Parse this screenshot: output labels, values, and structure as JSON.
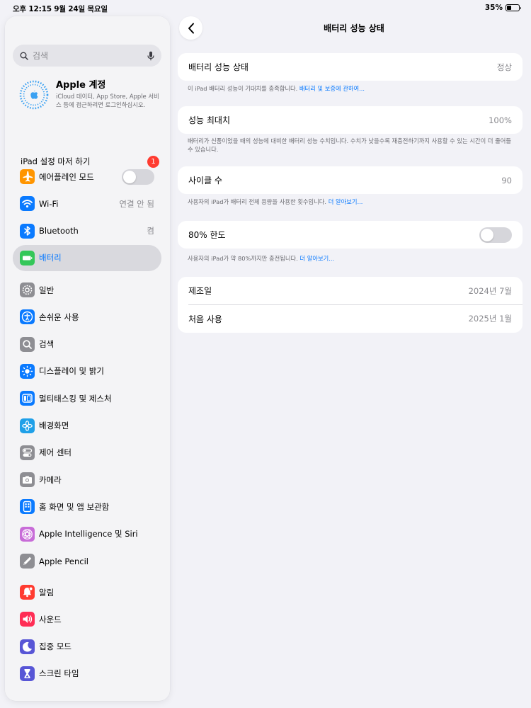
{
  "status_bar": {
    "time": "오후 12:15  9월 24일 목요일",
    "battery_pct": "35%",
    "battery_level": 0.35
  },
  "sidebar": {
    "search_placeholder": "검색",
    "apple_account": {
      "title": "Apple 계정",
      "desc": "iCloud 데이터, App Store, Apple 서비스 등에 접근하려면 로그인하십시오."
    },
    "setup": {
      "label": "iPad 설정 마저 하기",
      "badge": "1"
    },
    "groups": [
      [
        {
          "id": "airplane",
          "label": "에어플레인 모드",
          "icon": "airplane-icon",
          "color": "#ff9500",
          "toggle": false
        },
        {
          "id": "wifi",
          "label": "Wi-Fi",
          "icon": "wifi-icon",
          "color": "#0a7aff",
          "value": "연결 안 됨"
        },
        {
          "id": "bluetooth",
          "label": "Bluetooth",
          "icon": "bluetooth-icon",
          "color": "#0a7aff",
          "value": "켬"
        },
        {
          "id": "battery",
          "label": "배터리",
          "icon": "battery-icon",
          "color": "#34c759",
          "selected": true
        }
      ],
      [
        {
          "id": "general",
          "label": "일반",
          "icon": "gear-icon",
          "color": "#8e8e93"
        },
        {
          "id": "accessibility",
          "label": "손쉬운 사용",
          "icon": "accessibility-icon",
          "color": "#0a7aff"
        },
        {
          "id": "search",
          "label": "검색",
          "icon": "search-icon",
          "color": "#8e8e93"
        },
        {
          "id": "display",
          "label": "디스플레이 및 밝기",
          "icon": "brightness-icon",
          "color": "#0a7aff"
        },
        {
          "id": "multitasking",
          "label": "멀티태스킹 및 제스처",
          "icon": "multitasking-icon",
          "color": "#0a7aff"
        },
        {
          "id": "wallpaper",
          "label": "배경화면",
          "icon": "wallpaper-icon",
          "color": "#1fa0e8"
        },
        {
          "id": "control-center",
          "label": "제어 센터",
          "icon": "toggles-icon",
          "color": "#8e8e93"
        },
        {
          "id": "camera",
          "label": "카메라",
          "icon": "camera-icon",
          "color": "#8e8e93"
        },
        {
          "id": "home-screen",
          "label": "홈 화면 및 앱 보관함",
          "icon": "home-screen-icon",
          "color": "#0a7aff"
        },
        {
          "id": "siri",
          "label": "Apple Intelligence 및 Siri",
          "icon": "siri-icon",
          "color": "#c86cd8"
        },
        {
          "id": "pencil",
          "label": "Apple Pencil",
          "icon": "pencil-icon",
          "color": "#8e8e93"
        }
      ],
      [
        {
          "id": "notifications",
          "label": "알림",
          "icon": "bell-icon",
          "color": "#ff3b30"
        },
        {
          "id": "sounds",
          "label": "사운드",
          "icon": "speaker-icon",
          "color": "#ff2d55"
        },
        {
          "id": "focus",
          "label": "집중 모드",
          "icon": "moon-icon",
          "color": "#5856d6"
        },
        {
          "id": "screen-time",
          "label": "스크린 타임",
          "icon": "hourglass-icon",
          "color": "#5856d6"
        }
      ]
    ]
  },
  "main": {
    "title": "배터리 성능 상태",
    "battery_health": {
      "label": "배터리 성능 상태",
      "value": "정상",
      "note": "이 iPad 배터리 성능이 기대치를 충족합니다. ",
      "note_link": "배터리 및 보증에 관하여..."
    },
    "max_capacity": {
      "label": "성능 최대치",
      "value": "100%",
      "note": "배터리가 신품이었을 때의 성능에 대비한 배터리 성능 수치입니다. 수치가 낮을수록 재충전하기까지 사용할 수 있는 시간이 더 줄어들 수 있습니다."
    },
    "cycle_count": {
      "label": "사이클 수",
      "value": "90",
      "note": "사용자의 iPad가 배터리 전체 용량을 사용한 횟수입니다. ",
      "note_link": "더 알아보기..."
    },
    "limit": {
      "label": "80% 한도",
      "toggle": false,
      "note": "사용자의 iPad가 약 80%까지만 충전됩니다. ",
      "note_link": "더 알아보기..."
    },
    "dates": [
      {
        "label": "제조일",
        "value": "2024년 7월"
      },
      {
        "label": "처음 사용",
        "value": "2025년 1월"
      }
    ]
  }
}
